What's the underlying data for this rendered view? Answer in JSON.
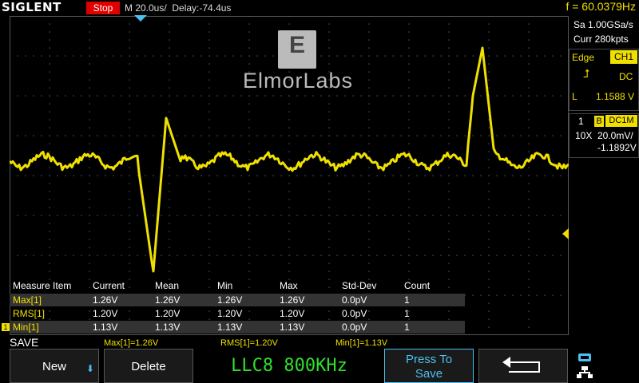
{
  "header": {
    "brand": "SIGLENT",
    "run_state": "Stop",
    "timebase": "M 20.0us/",
    "delay": "Delay:-74.4us",
    "frequency": "f = 60.0379Hz"
  },
  "watermark": {
    "logo_letter": "E",
    "text": "ElmorLabs"
  },
  "acquisition": {
    "sample_rate": "Sa 1.00GSa/s",
    "memory_depth": "Curr 280kpts"
  },
  "trigger": {
    "type": "Edge",
    "source": "CH1",
    "coupling": "DC",
    "level_label": "L",
    "level": "1.1588 V"
  },
  "channel1": {
    "number": "1",
    "bandwidth_flag": "B",
    "coupling": "DC1M",
    "probe": "10X",
    "scale": "20.0mV/",
    "offset": "-1.1892V",
    "marker": "1"
  },
  "measurements": {
    "headers": [
      "Measure Item",
      "Current",
      "Mean",
      "Min",
      "Max",
      "Std-Dev",
      "Count"
    ],
    "rows": [
      {
        "item": "Max[1]",
        "current": "1.26V",
        "mean": "1.26V",
        "min": "1.26V",
        "max": "1.26V",
        "std_dev": "0.0pV",
        "count": "1"
      },
      {
        "item": "RMS[1]",
        "current": "1.20V",
        "mean": "1.20V",
        "min": "1.20V",
        "max": "1.20V",
        "std_dev": "0.0pV",
        "count": "1"
      },
      {
        "item": "Min[1]",
        "current": "1.13V",
        "mean": "1.13V",
        "min": "1.13V",
        "max": "1.13V",
        "std_dev": "0.0pV",
        "count": "1"
      }
    ]
  },
  "summary": {
    "max": "Max[1]=1.26V",
    "rms": "RMS[1]=1.20V",
    "min": "Min[1]=1.13V"
  },
  "menu": {
    "title": "SAVE",
    "new_label": "New",
    "delete_label": "Delete",
    "filename": "LLC8 800KHz",
    "save_line1": "Press To",
    "save_line2": "Save"
  },
  "colors": {
    "trace": "#f0e000",
    "accent": "#4cc0f0",
    "stop": "#e00000",
    "filename": "#2ee02e"
  }
}
